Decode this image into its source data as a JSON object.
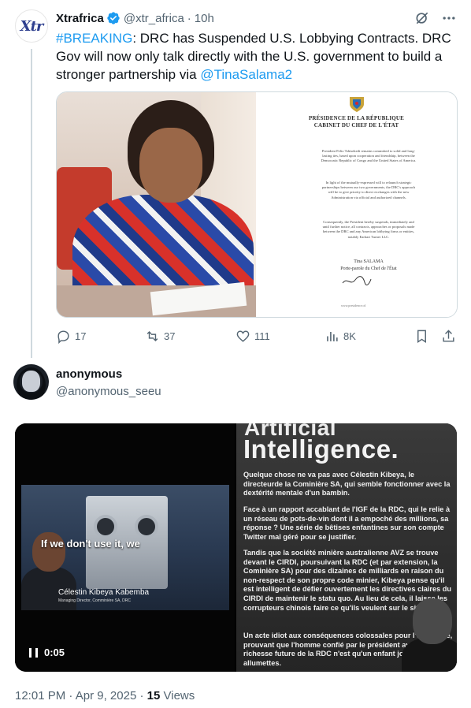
{
  "tweet1": {
    "author_name": "Xtrafrica",
    "author_handle": "@xtr_africa",
    "separator": "·",
    "time": "10h",
    "avatar_text": "Xtr",
    "text_hashtag": "#BREAKING",
    "text_body": ": DRC has Suspended U.S. Lobbying Contracts. DRC Gov will now only talk directly with the U.S. government to build a stronger partnership via ",
    "text_mention": "@TinaSalama2",
    "document": {
      "header_line1": "PRÉSIDENCE DE LA RÉPUBLIQUE",
      "header_line2": "CABINET DU CHEF DE L'ÉTAT",
      "paragraph1": "President Felix Tshisekedi remains committed to solid and long-lasting ties, based upon cooperation and friendship, between the Democratic Republic of Congo and the United States of America.",
      "paragraph2": "In light of the mutually-expressed will to relaunch strategic partnerships between our two governments, the DRC's approach will be to give priority to direct exchanges with the new Administration via official and authorized channels.",
      "paragraph3": "Consequently, the President hereby suspends, immediately and until further notice, all contracts, approaches or proposals made between the DRC and any American lobbying firms or entities, notably Earhart Turner LLC.",
      "signatory": "Tina SALAMA",
      "signatory_title": "Porte-parole du Chef de l'État",
      "footer": "www.presidence.cd"
    },
    "actions": {
      "replies": "17",
      "reposts": "37",
      "likes": "111",
      "views": "8K"
    }
  },
  "tweet2": {
    "author_name": "anonymous",
    "author_handle": "@anonymous_seeu",
    "video": {
      "caption": "If we don't use it, we",
      "lower_third_name": "Célestin Kibeya Kabemba",
      "lower_third_title": "Managing Director, Comminière SA, DRC",
      "timestamp": "0:05"
    },
    "poster": {
      "title_top": "Artificial",
      "title": "Intelligence.",
      "p1": "Quelque chose ne va pas avec Célestin Kibeya, le directeurde la Cominière SA, qui semble fonctionner avec la dextérité mentale d'un bambin.",
      "p2": "Face à un rapport accablant de l'IGF de la RDC, qui le relie à un réseau de pots-de-vin dont il a empoché des millions, sa réponse ? Une série de bêtises enfantines sur son compte Twitter mal géré pour se justifier.",
      "p3": "Tandis que la société minière australienne AVZ se trouve devant le CIRDI, poursuivant la RDC (et par extension, la Cominière SA) pour des dizaines de milliards en raison du non-respect de son propre code minier, Kibeya pense qu'il est intelligent de défier ouvertement les directives claires du CIRDI de maintenir le statu quo. Au lieu de cela, il laisse les corrupteurs chinois faire ce qu'ils veulent sur le site.",
      "p4": "Un acte idiot aux conséquences colossales pour l'économie, prouvant que l'homme confié par le président avec la richesse future de la RDC n'est qu'un enfant jouant avec des allumettes."
    },
    "meta": {
      "time": "12:01 PM",
      "date": "Apr 9, 2025",
      "separator": "·",
      "views_count": "15",
      "views_label": "Views"
    }
  },
  "colors": {
    "accent": "#1d9bf0",
    "text": "#0f1419",
    "muted": "#536471",
    "border": "#cfd9de"
  }
}
